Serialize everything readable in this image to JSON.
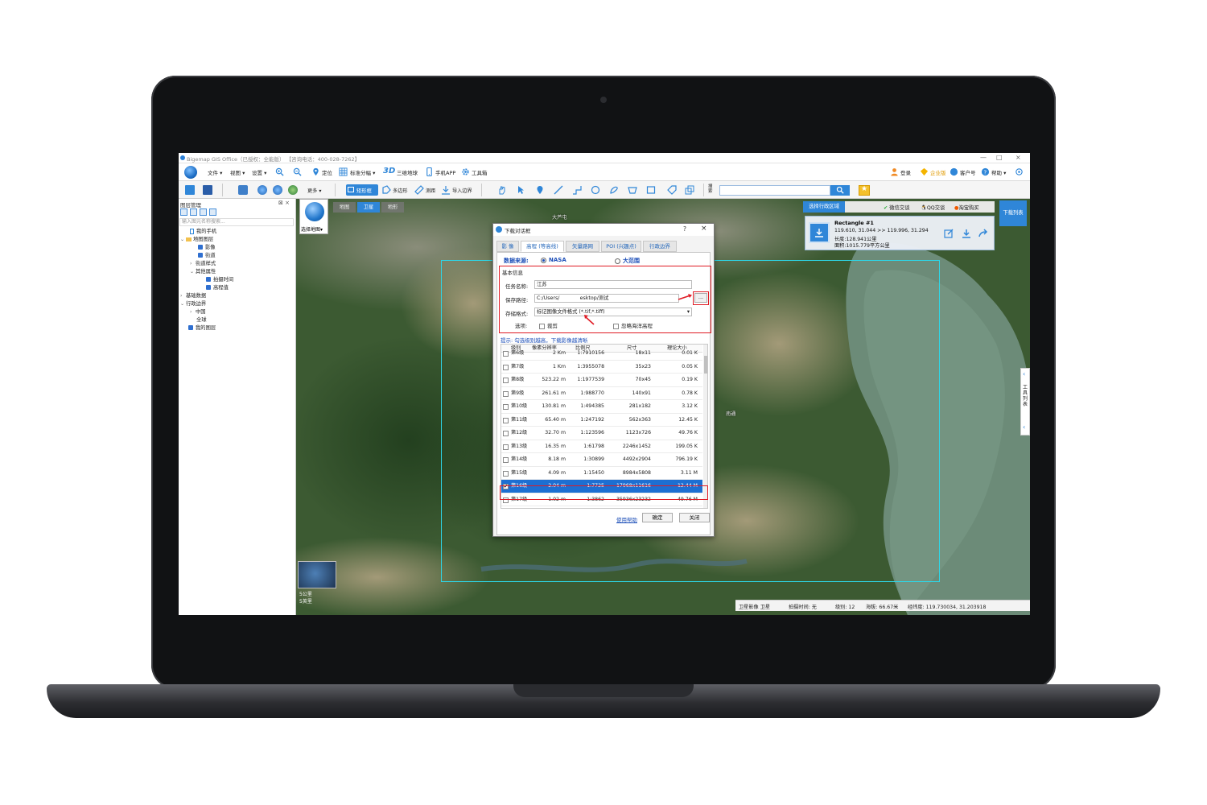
{
  "window": {
    "title": "Bigemap GIS Office（已授权：全能版）  【咨询电话：400-028-7262】"
  },
  "menu": {
    "file": "文件",
    "view": "视图",
    "settings": "设置",
    "locate": "定位",
    "standard_grid": "标准分幅",
    "three_d": "3D",
    "three_d_globe": "三维地球",
    "mobile_app": "手机APP",
    "toolbox": "工具箱",
    "login": "登录",
    "enterprise": "企业版",
    "customer": "客户号",
    "help": "帮助"
  },
  "toolbar": {
    "more": "更多",
    "rectangle": "矩形框",
    "polygon": "多边形",
    "measure": "测距",
    "import_boundary": "导入边界",
    "search_label": "搜索",
    "search_placeholder": ""
  },
  "layer_panel": {
    "title": "图层管理",
    "search_placeholder": "输入图元名称搜索...",
    "items": [
      {
        "label": "我的手机"
      },
      {
        "label": "地图图层"
      },
      {
        "label": "影像"
      },
      {
        "label": "街道"
      },
      {
        "label": "街道样式"
      },
      {
        "label": "其他属性"
      },
      {
        "label": "拍摄时间"
      },
      {
        "label": "高程值"
      },
      {
        "label": "基础数据"
      },
      {
        "label": "行政边界"
      },
      {
        "label": "中国"
      },
      {
        "label": "全球"
      },
      {
        "label": "我的图层"
      }
    ]
  },
  "map": {
    "tabs": [
      "地图",
      "卫星",
      "地形"
    ],
    "selected_tab": "卫星",
    "layer_picker_label": "选择地图",
    "place_labels": [
      "大芦屯",
      "南通"
    ],
    "scale_labels": [
      "5公里",
      "5英里"
    ],
    "top_right": {
      "select_admin": "选择行政区域",
      "wechat": "微信交谈",
      "qq": "QQ交谈",
      "taobao": "淘宝购买",
      "download_list": "下载列表"
    },
    "rect_card": {
      "name": "Rectangle #1",
      "coords": "119.610,  31.044 >> 119.996,  31.294",
      "length": "长度:128.941公里",
      "area": "面积:1015.779平方公里"
    },
    "side_tools_label": "工具列表",
    "status": {
      "source": "卫星影像 卫星",
      "capture_time": "拍摄时间: 无",
      "level": "级别:  12",
      "altitude": "海拔: 66.67米",
      "lonlat": "经纬度:   119.730034,  31.203918"
    }
  },
  "dialog": {
    "title": "下载对话框",
    "tabs": [
      "影  像",
      "高程 (等高线)",
      "矢量路网",
      "POI (兴趣点)",
      "行政边界"
    ],
    "selected_tab": "高程 (等高线)",
    "data_source_label": "数据来源:",
    "source_nasa": "NASA",
    "source_large": "大范围",
    "basic_info": "基本信息",
    "task_name_label": "任务名称:",
    "task_name_value": "江苏",
    "save_path_label": "保存路径:",
    "save_path_value": "C:/Users/    esktop/测试",
    "browse": "...",
    "format_label": "存储格式:",
    "format_value": "标记图像文件格式 (*.tif,*.tiff)",
    "options_label": "选项:",
    "option_clip": "裁剪",
    "option_ignore_sea": "忽略海洋高程",
    "hint": "提示: 勾选级别越高，下载影像越清晰",
    "table_headers": [
      "级别",
      "像素分辨率",
      "比例尺",
      "尺寸",
      "理论大小"
    ],
    "table_rows": [
      {
        "level": "第6级",
        "res": "2 Km",
        "scale": "1:7910156",
        "size": "18x11",
        "est": "0.01 K"
      },
      {
        "level": "第7级",
        "res": "1 Km",
        "scale": "1:3955078",
        "size": "35x23",
        "est": "0.05 K"
      },
      {
        "level": "第8级",
        "res": "523.22  m",
        "scale": "1:1977539",
        "size": "70x45",
        "est": "0.19 K"
      },
      {
        "level": "第9级",
        "res": "261.61  m",
        "scale": "1:988770",
        "size": "140x91",
        "est": "0.78 K"
      },
      {
        "level": "第10级",
        "res": "130.81  m",
        "scale": "1:494385",
        "size": "281x182",
        "est": "3.12 K"
      },
      {
        "level": "第11级",
        "res": "65.40  m",
        "scale": "1:247192",
        "size": "562x363",
        "est": "12.45 K"
      },
      {
        "level": "第12级",
        "res": "32.70  m",
        "scale": "1:123596",
        "size": "1123x726",
        "est": "49.76 K"
      },
      {
        "level": "第13级",
        "res": "16.35  m",
        "scale": "1:61798",
        "size": "2246x1452",
        "est": "199.05 K"
      },
      {
        "level": "第14级",
        "res": "8.18  m",
        "scale": "1:30899",
        "size": "4492x2904",
        "est": "796.19 K"
      },
      {
        "level": "第15级",
        "res": "4.09  m",
        "scale": "1:15450",
        "size": "8984x5808",
        "est": "3.11 M"
      },
      {
        "level": "第16级",
        "res": "2.04  m",
        "scale": "1:7725",
        "size": "17968x11616",
        "est": "12.44 M",
        "selected": true
      },
      {
        "level": "第17级",
        "res": "1.02  m",
        "scale": "1:3862",
        "size": "35936x23232",
        "est": "49.76 M"
      }
    ],
    "help_link": "使用帮助",
    "ok": "确定",
    "close": "关闭"
  },
  "colors": {
    "accent": "#2f86d8",
    "highlight_border": "#e01b24",
    "selection_rect": "#2dd7e8"
  }
}
